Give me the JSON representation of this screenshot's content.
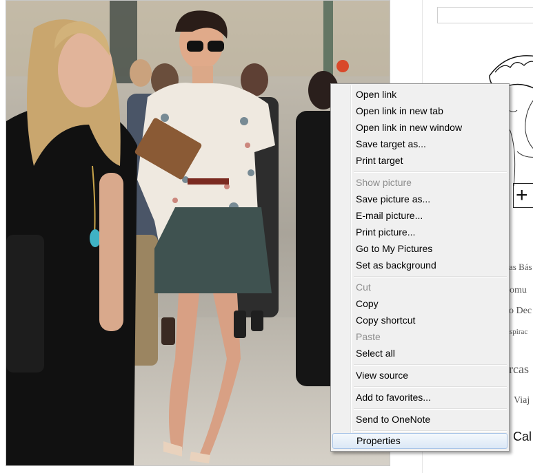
{
  "page": {
    "right_sidebar": {
      "search_placeholder": "",
      "snippets": [
        "as  Bás",
        "omu",
        "o  Dec",
        "spirac",
        "rcas",
        "Viaj"
      ],
      "cal_text": "Cal",
      "plus_glyph": "+"
    }
  },
  "context_menu": {
    "items": [
      {
        "label": "Open link",
        "enabled": true
      },
      {
        "label": "Open link in new tab",
        "enabled": true
      },
      {
        "label": "Open link in new window",
        "enabled": true
      },
      {
        "label": "Save target as...",
        "enabled": true
      },
      {
        "label": "Print target",
        "enabled": true
      },
      {
        "label": "Show picture",
        "enabled": false
      },
      {
        "label": "Save picture as...",
        "enabled": true
      },
      {
        "label": "E-mail picture...",
        "enabled": true
      },
      {
        "label": "Print picture...",
        "enabled": true
      },
      {
        "label": "Go to My Pictures",
        "enabled": true
      },
      {
        "label": "Set as background",
        "enabled": true
      },
      {
        "label": "Cut",
        "enabled": false
      },
      {
        "label": "Copy",
        "enabled": true
      },
      {
        "label": "Copy shortcut",
        "enabled": true
      },
      {
        "label": "Paste",
        "enabled": false
      },
      {
        "label": "Select all",
        "enabled": true
      },
      {
        "label": "View source",
        "enabled": true
      },
      {
        "label": "Add to favorites...",
        "enabled": true
      },
      {
        "label": "Send to OneNote",
        "enabled": true
      },
      {
        "label": "Properties",
        "enabled": true,
        "highlighted": true
      }
    ]
  },
  "colors": {
    "menu_bg": "#f0f0f0",
    "menu_border": "#979797",
    "highlight_border": "#a9c5e8",
    "disabled_text": "#8d8d8d"
  }
}
